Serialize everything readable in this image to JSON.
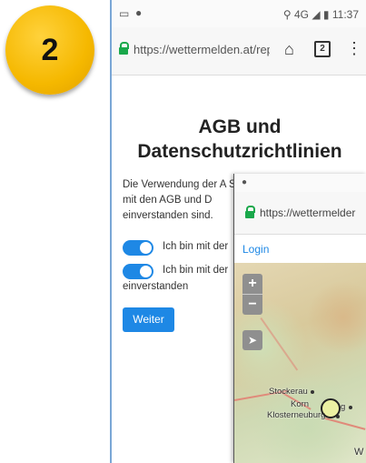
{
  "badge": {
    "number": "2"
  },
  "phone1": {
    "status": {
      "network": "4G",
      "time": "11:37"
    },
    "browser": {
      "url": "https://wettermelden.at/rep",
      "tab_count": "2"
    },
    "title_line1": "AGB und",
    "title_line2": "Datenschutzrichtlinien",
    "paragraph": "Die Verwendung der A Sie mit den AGB und D einverstanden sind.",
    "toggle1_label": "Ich bin mit der",
    "toggle2_label": "Ich bin mit der",
    "toggle2_cont": "einverstanden",
    "weiter_button": "Weiter"
  },
  "phone2": {
    "browser": {
      "url": "https://wettermelder"
    },
    "login_link": "Login",
    "map": {
      "zoom_in": "+",
      "zoom_out": "−",
      "locate": "➤",
      "places": {
        "stockerau": "Stockerau",
        "korn": "Korn",
        "korn_suffix": "g",
        "klosterneuburg": "Klosterneuburg",
        "w": "W"
      }
    }
  },
  "colors": {
    "accent": "#1e88e5",
    "lock": "#1aa84b",
    "badge": "#f5b800"
  }
}
